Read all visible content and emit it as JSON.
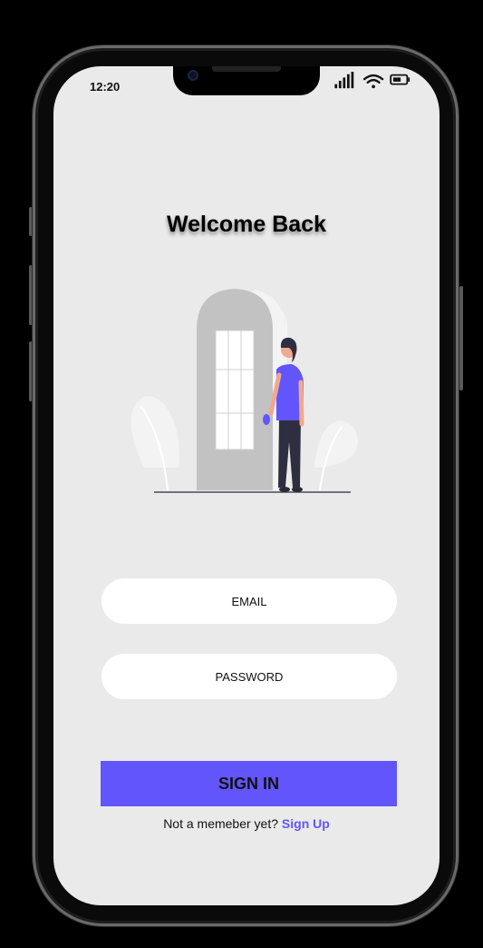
{
  "status_bar": {
    "time": "12:20"
  },
  "welcome": {
    "title": "Welcome Back"
  },
  "form": {
    "email_placeholder": "EMAIL",
    "password_placeholder": "PASSWORD",
    "signin_label": "SIGN IN"
  },
  "footer": {
    "prompt": "Not a memeber yet?",
    "signup_label": "Sign Up"
  },
  "colors": {
    "accent": "#6255fb",
    "screen_bg": "#eaeaea",
    "door": "#c2c2c2"
  },
  "icons": [
    "signal-icon",
    "wifi-icon",
    "battery-icon",
    "door-illustration"
  ]
}
